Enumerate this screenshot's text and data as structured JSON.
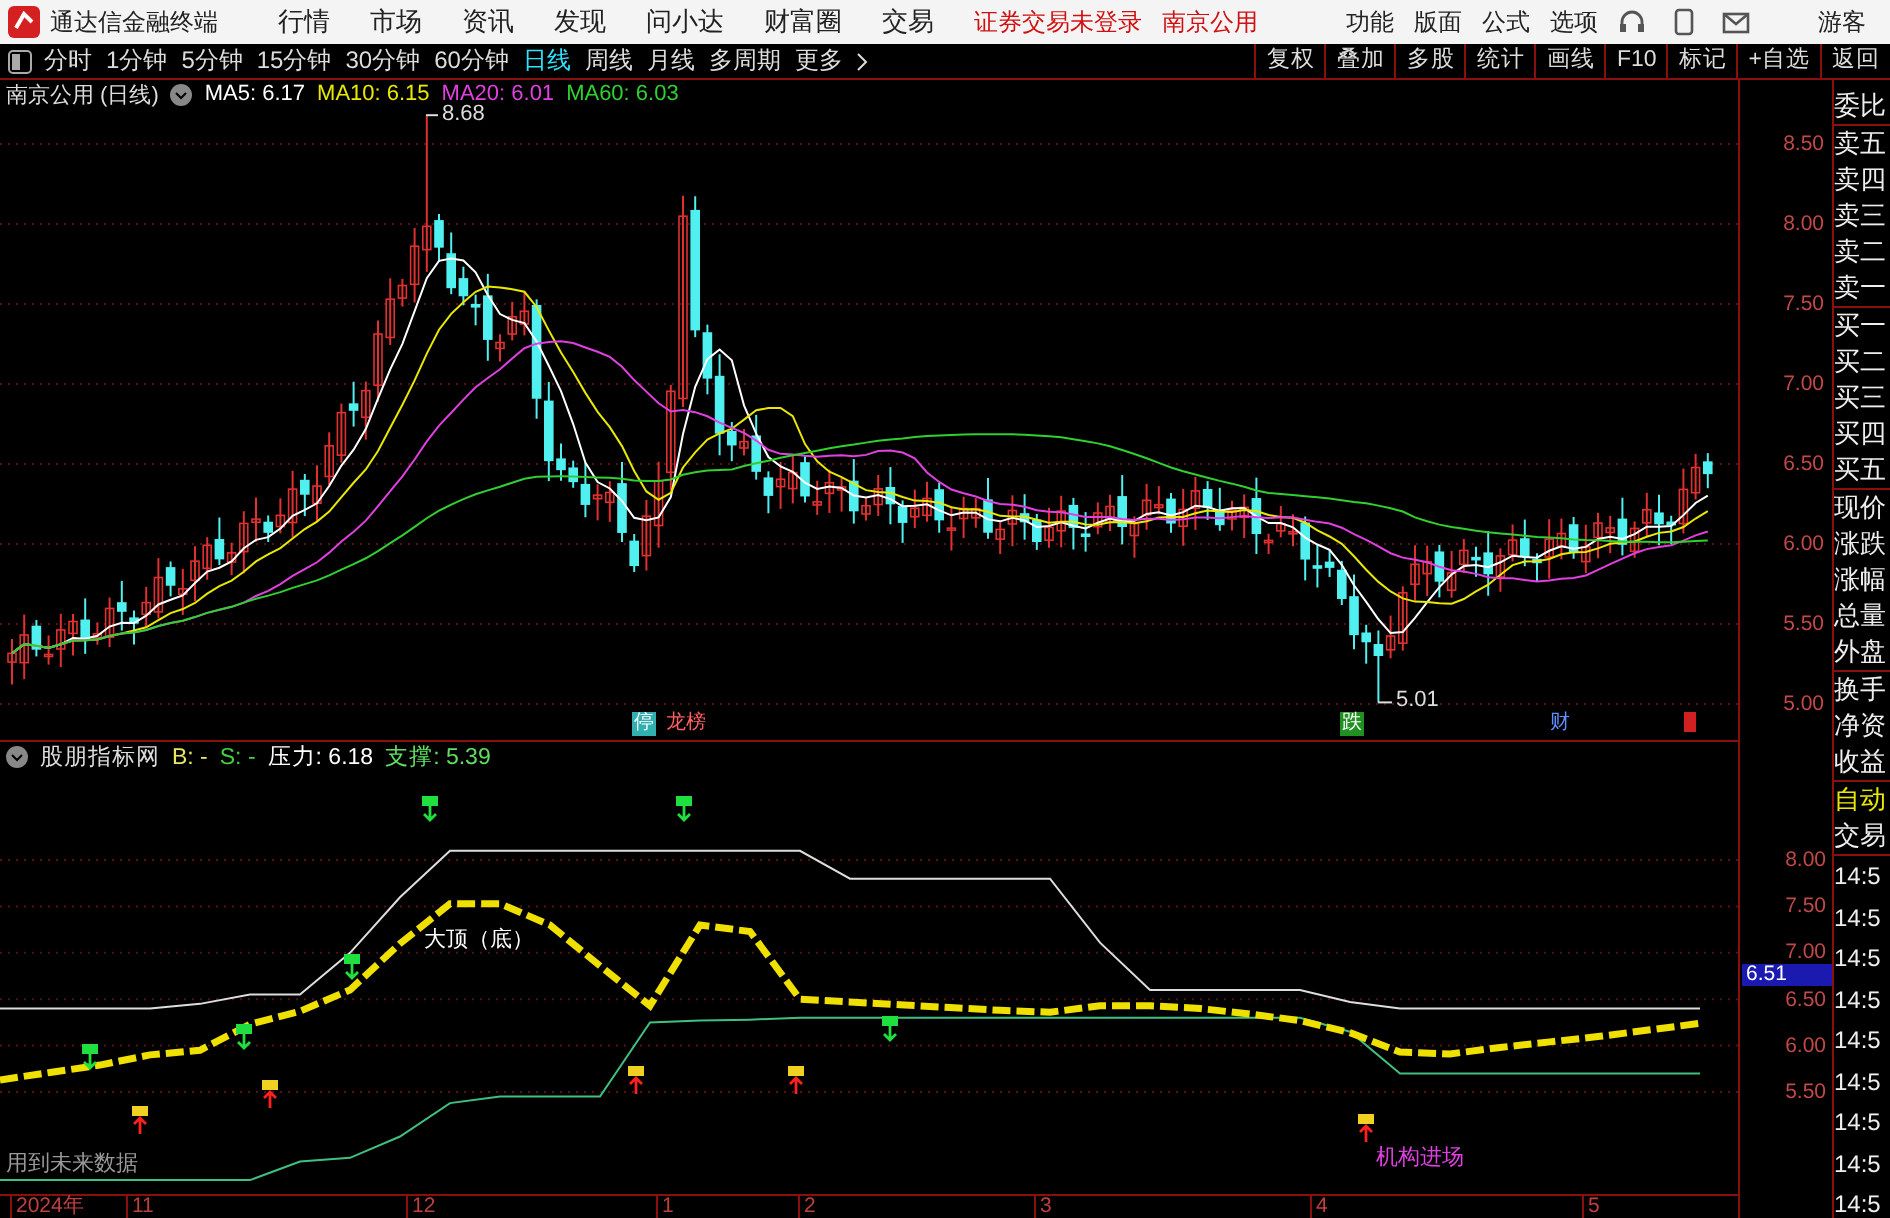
{
  "window": {
    "title": "通达信金融终端"
  },
  "menu": [
    "行情",
    "市场",
    "资讯",
    "发现",
    "问小达",
    "财富圈",
    "交易"
  ],
  "status": {
    "login": "证券交易未登录",
    "stock": "南京公用"
  },
  "right_menu": [
    "功能",
    "版面",
    "公式",
    "选项"
  ],
  "user": "游客",
  "periods": [
    {
      "label": "分时",
      "selected": false
    },
    {
      "label": "1分钟",
      "selected": false
    },
    {
      "label": "5分钟",
      "selected": false
    },
    {
      "label": "15分钟",
      "selected": false
    },
    {
      "label": "30分钟",
      "selected": false
    },
    {
      "label": "60分钟",
      "selected": false
    },
    {
      "label": "日线",
      "selected": true
    },
    {
      "label": "周线",
      "selected": false
    },
    {
      "label": "月线",
      "selected": false
    },
    {
      "label": "多周期",
      "selected": false
    },
    {
      "label": "更多",
      "selected": false
    }
  ],
  "tools": [
    "复权",
    "叠加",
    "多股",
    "统计",
    "画线",
    "F10",
    "标记",
    "+自选",
    "返回"
  ],
  "main_chart": {
    "title": "南京公用 (日线)",
    "indicators": [
      {
        "label": "MA5: 6.17",
        "color": "#ffffff"
      },
      {
        "label": "MA10: 6.15",
        "color": "#e8e800"
      },
      {
        "label": "MA20: 6.01",
        "color": "#e040e0"
      },
      {
        "label": "MA60: 6.03",
        "color": "#30d030"
      }
    ],
    "high_label": "8.68",
    "low_label": "5.01",
    "markers": [
      {
        "label": "停",
        "kind": "suspend"
      },
      {
        "label": "龙榜",
        "kind": "list"
      },
      {
        "label": "跌",
        "kind": "drop"
      },
      {
        "label": "财",
        "kind": "finance"
      }
    ],
    "y_ticks": [
      "8.50",
      "8.00",
      "7.50",
      "7.00",
      "6.50",
      "6.00",
      "5.50",
      "5.00"
    ]
  },
  "lower_chart": {
    "title": "股朋指标网",
    "values": [
      {
        "label": "B: -",
        "color": "#e8e860"
      },
      {
        "label": "S: -",
        "color": "#40d040"
      },
      {
        "label": "压力: 6.18",
        "color": "#ffffff"
      },
      {
        "label": "支撑: 5.39",
        "color": "#60e060"
      }
    ],
    "top_label": "大顶（底）",
    "signal_label": "机构进场",
    "note": "用到未来数据",
    "price_tag": "6.51",
    "chart_data": {
      "type": "line",
      "ylim": [
        4.4,
        8.95
      ],
      "grid": true,
      "yticks": [
        {
          "value": 8,
          "label": "8.00"
        },
        {
          "value": 7.5,
          "label": "7.50"
        },
        {
          "value": 7,
          "label": "7.00"
        },
        {
          "value": 6.5,
          "label": "6.50"
        },
        {
          "value": 6,
          "label": "6.00"
        },
        {
          "value": 5.5,
          "label": "5.50"
        }
      ],
      "series": [
        {
          "color": "#dddddd",
          "values": [
            6.4,
            6.4,
            6.4,
            6.4,
            6.45,
            6.55,
            6.55,
            7.0,
            7.6,
            8.1,
            8.1,
            8.1,
            8.1,
            8.1,
            8.1,
            8.1,
            8.1,
            7.8,
            7.8,
            7.8,
            7.8,
            7.8,
            7.11,
            6.6,
            6.6,
            6.6,
            6.6,
            6.47,
            6.4,
            6.4,
            6.4,
            6.4,
            6.4,
            6.4,
            6.4
          ]
        },
        {
          "color": "#40c080",
          "values": [
            4.55,
            4.55,
            4.55,
            4.55,
            4.55,
            4.55,
            4.75,
            4.79,
            5.02,
            5.38,
            5.45,
            5.45,
            5.45,
            6.25,
            6.27,
            6.28,
            6.3,
            6.3,
            6.3,
            6.3,
            6.3,
            6.3,
            6.3,
            6.3,
            6.3,
            6.3,
            6.3,
            6.15,
            5.7,
            5.7,
            5.7,
            5.7,
            5.7,
            5.7,
            5.7
          ]
        },
        {
          "color": "#f0e000",
          "line_style": "dashed",
          "values": [
            5.63,
            5.71,
            5.79,
            5.9,
            5.95,
            6.23,
            6.37,
            6.6,
            7.1,
            7.53,
            7.53,
            7.3,
            6.86,
            6.43,
            7.3,
            7.23,
            6.5,
            6.47,
            6.44,
            6.41,
            6.38,
            6.36,
            6.43,
            6.43,
            6.4,
            6.34,
            6.27,
            6.14,
            5.93,
            5.91,
            5.98,
            6.04,
            6.1,
            6.17,
            6.24
          ]
        }
      ]
    }
  },
  "x_axis": [
    "2024年",
    "11",
    "12",
    "1",
    "2",
    "3",
    "4",
    "5"
  ],
  "side_panel": {
    "groups": [
      [
        "委比"
      ],
      [
        "卖五",
        "卖四",
        "卖三",
        "卖二",
        "卖一"
      ],
      [
        "买一",
        "买二",
        "买三",
        "买四",
        "买五"
      ],
      [
        "现价",
        "涨跌",
        "涨幅",
        "总量",
        "外盘"
      ],
      [
        "换手",
        "净资",
        "收益"
      ]
    ],
    "trade_tabs": [
      {
        "label": "自动",
        "selected": true
      },
      {
        "label": "交易",
        "selected": false
      }
    ],
    "times": [
      "14:5",
      "14:5",
      "14:5",
      "14:5",
      "14:5",
      "14:5",
      "14:5",
      "14:5",
      "14:5"
    ]
  }
}
